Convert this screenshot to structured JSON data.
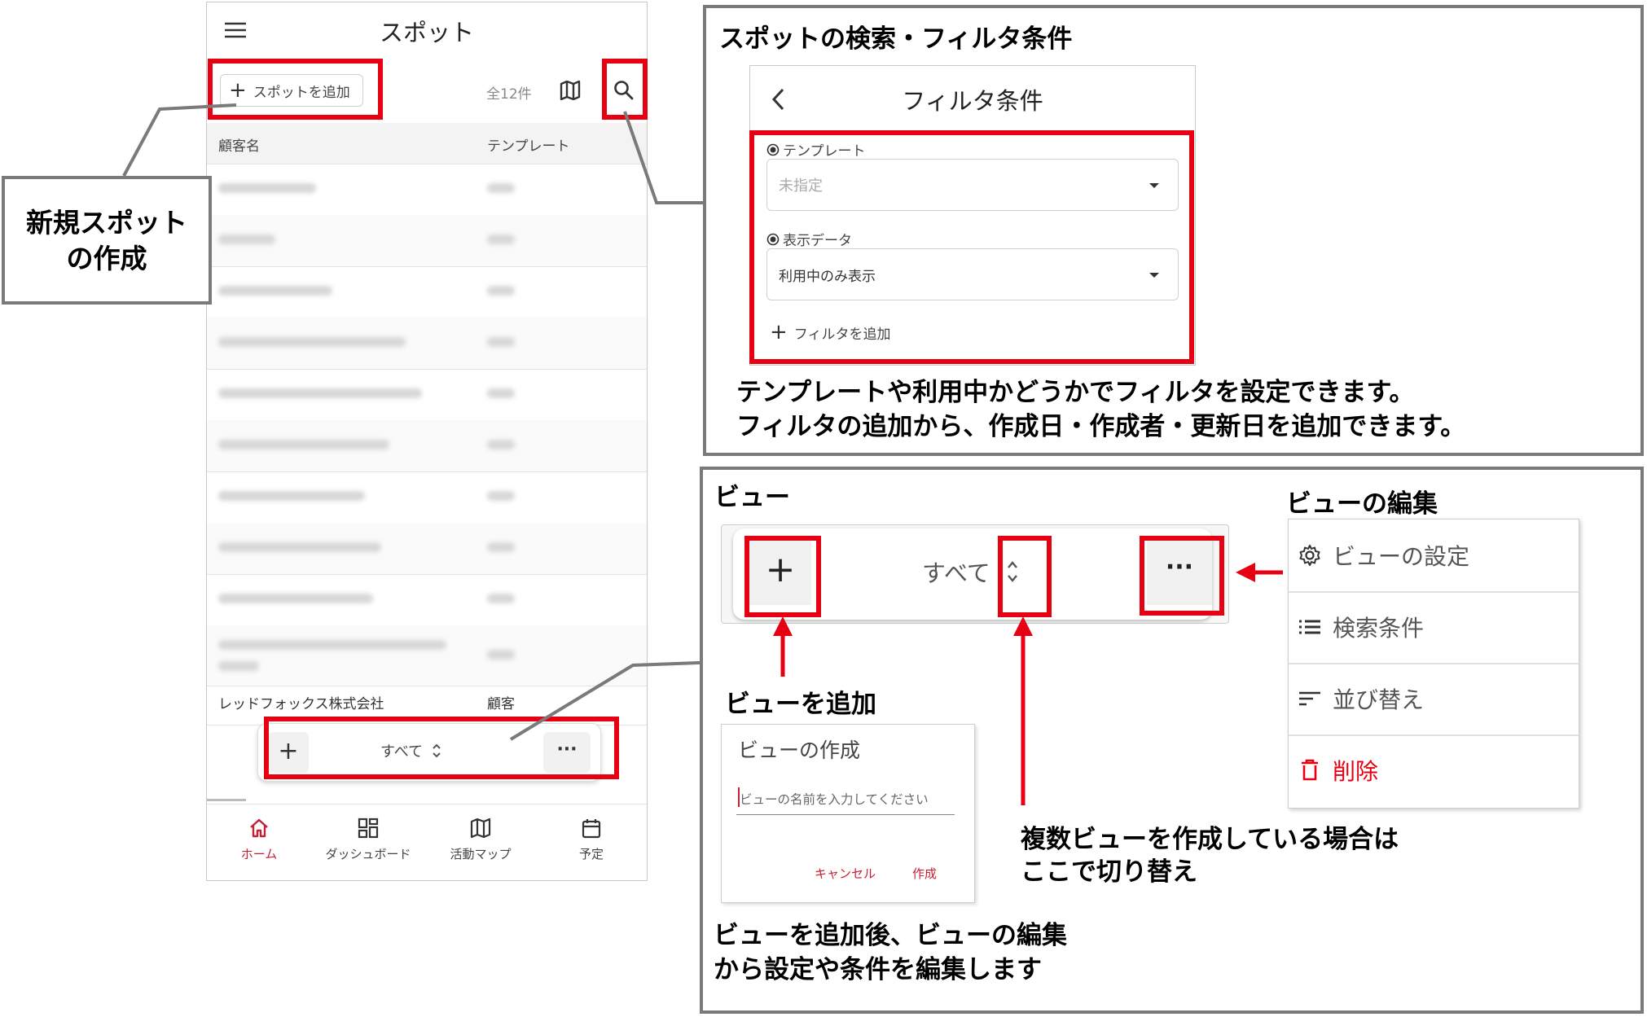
{
  "phone": {
    "title": "スポット",
    "add_spot_label": "スポットを追加",
    "count_label": "全12件",
    "columns": [
      "顧客名",
      "テンプレート"
    ],
    "last_row": {
      "customer": "レッドフォックス株式会社",
      "template": "顧客"
    },
    "view_bar": {
      "label": "すべて"
    },
    "nav": [
      {
        "label": "ホーム",
        "icon": "home-icon"
      },
      {
        "label": "ダッシュボード",
        "icon": "dashboard-icon"
      },
      {
        "label": "活動マップ",
        "icon": "map-icon"
      },
      {
        "label": "予定",
        "icon": "calendar-icon"
      }
    ]
  },
  "callout_new_spot": {
    "text": "新規スポット\nの作成"
  },
  "filter_section": {
    "heading": "スポットの検索・フィルタ条件",
    "panel_title": "フィルタ条件",
    "template_label": "テンプレート",
    "template_value": "未指定",
    "display_label": "表示データ",
    "display_value": "利用中のみ表示",
    "add_filter_label": "フィルタを追加",
    "desc_line1": "テンプレートや利用中かどうかでフィルタを設定できます。",
    "desc_line2": "フィルタの追加から、作成日・作成者・更新日を追加できます。"
  },
  "view_section": {
    "heading": "ビュー",
    "bar_label": "すべて",
    "edit_heading": "ビューの編集",
    "menu": [
      {
        "label": "ビューの設定",
        "icon": "gear-icon"
      },
      {
        "label": "検索条件",
        "icon": "list-icon"
      },
      {
        "label": "並び替え",
        "icon": "sort-icon"
      },
      {
        "label": "削除",
        "icon": "trash-icon"
      }
    ],
    "add_view_label": "ビューを追加",
    "dialog_title": "ビューの作成",
    "dialog_placeholder": "ビューの名前を入力してください",
    "dialog_cancel": "キャンセル",
    "dialog_create": "作成",
    "switch_note_line1": "複数ビューを作成している場合は",
    "switch_note_line2": "ここで切り替え",
    "after_note_line1": "ビューを追加後、ビューの編集",
    "after_note_line2": "から設定や条件を編集します"
  },
  "colors": {
    "accent_red": "#e60012",
    "brand_red": "#c62034",
    "frame_gray": "#7a7a7a"
  }
}
